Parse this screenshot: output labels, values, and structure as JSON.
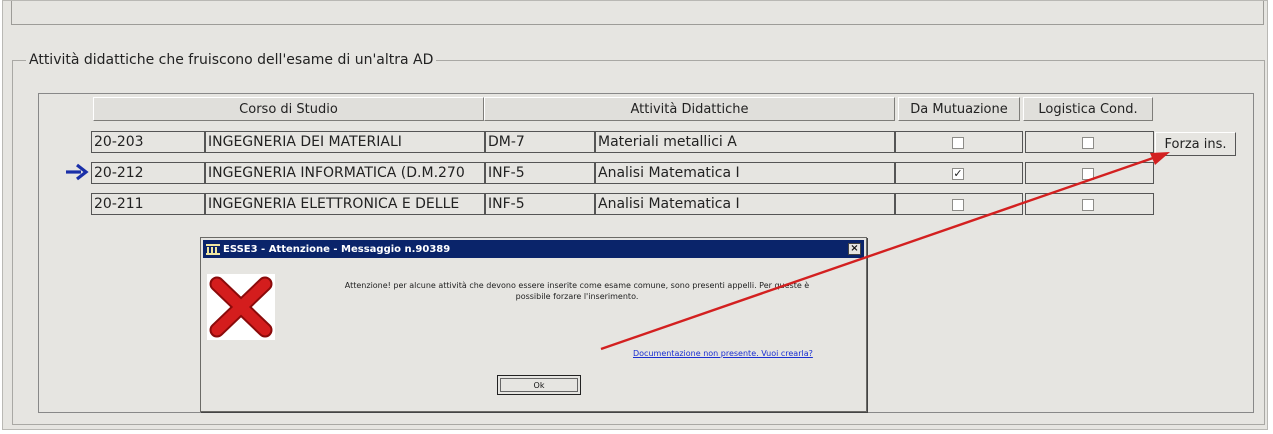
{
  "section": {
    "title": "Attività didattiche che fruiscono dell'esame di un'altra AD"
  },
  "table": {
    "headers": {
      "corso": "Corso di Studio",
      "attivita": "Attività Didattiche",
      "mutuazione": "Da Mutuazione",
      "logistica": "Logistica Cond."
    },
    "rows": [
      {
        "code": "20-203",
        "course": "INGEGNERIA DEI MATERIALI",
        "ad_code": "DM-7",
        "ad_name": "Materiali metallici A",
        "mutuazione": false,
        "logistica": false
      },
      {
        "code": "20-212",
        "course": "INGEGNERIA INFORMATICA (D.M.270",
        "ad_code": "INF-5",
        "ad_name": "Analisi Matematica I",
        "mutuazione": true,
        "logistica": false
      },
      {
        "code": "20-211",
        "course": "INGEGNERIA ELETTRONICA E DELLE",
        "ad_code": "INF-5",
        "ad_name": "Analisi Matematica I",
        "mutuazione": false,
        "logistica": false
      }
    ],
    "current_row_indicator": "arrow-right"
  },
  "buttons": {
    "forza": "Forza ins."
  },
  "dialog": {
    "title": "ESSE3 - Attenzione  - Messaggio n.90389",
    "icon": "error-x-icon",
    "message_line1": "Attenzione! per alcune attività che devono essere inserite come esame comune, sono presenti appelli. Per queste è",
    "message_line2": "possibile forzare l'inserimento.",
    "link": "Documentazione non presente. Vuoi crearla?",
    "ok": "Ok",
    "close": "×"
  },
  "colors": {
    "background": "#e6e5e1",
    "titlebar": "#0a246a",
    "annotation_arrow": "#d32020",
    "row_indicator": "#1a2fa8",
    "link": "#1a2fd1"
  }
}
